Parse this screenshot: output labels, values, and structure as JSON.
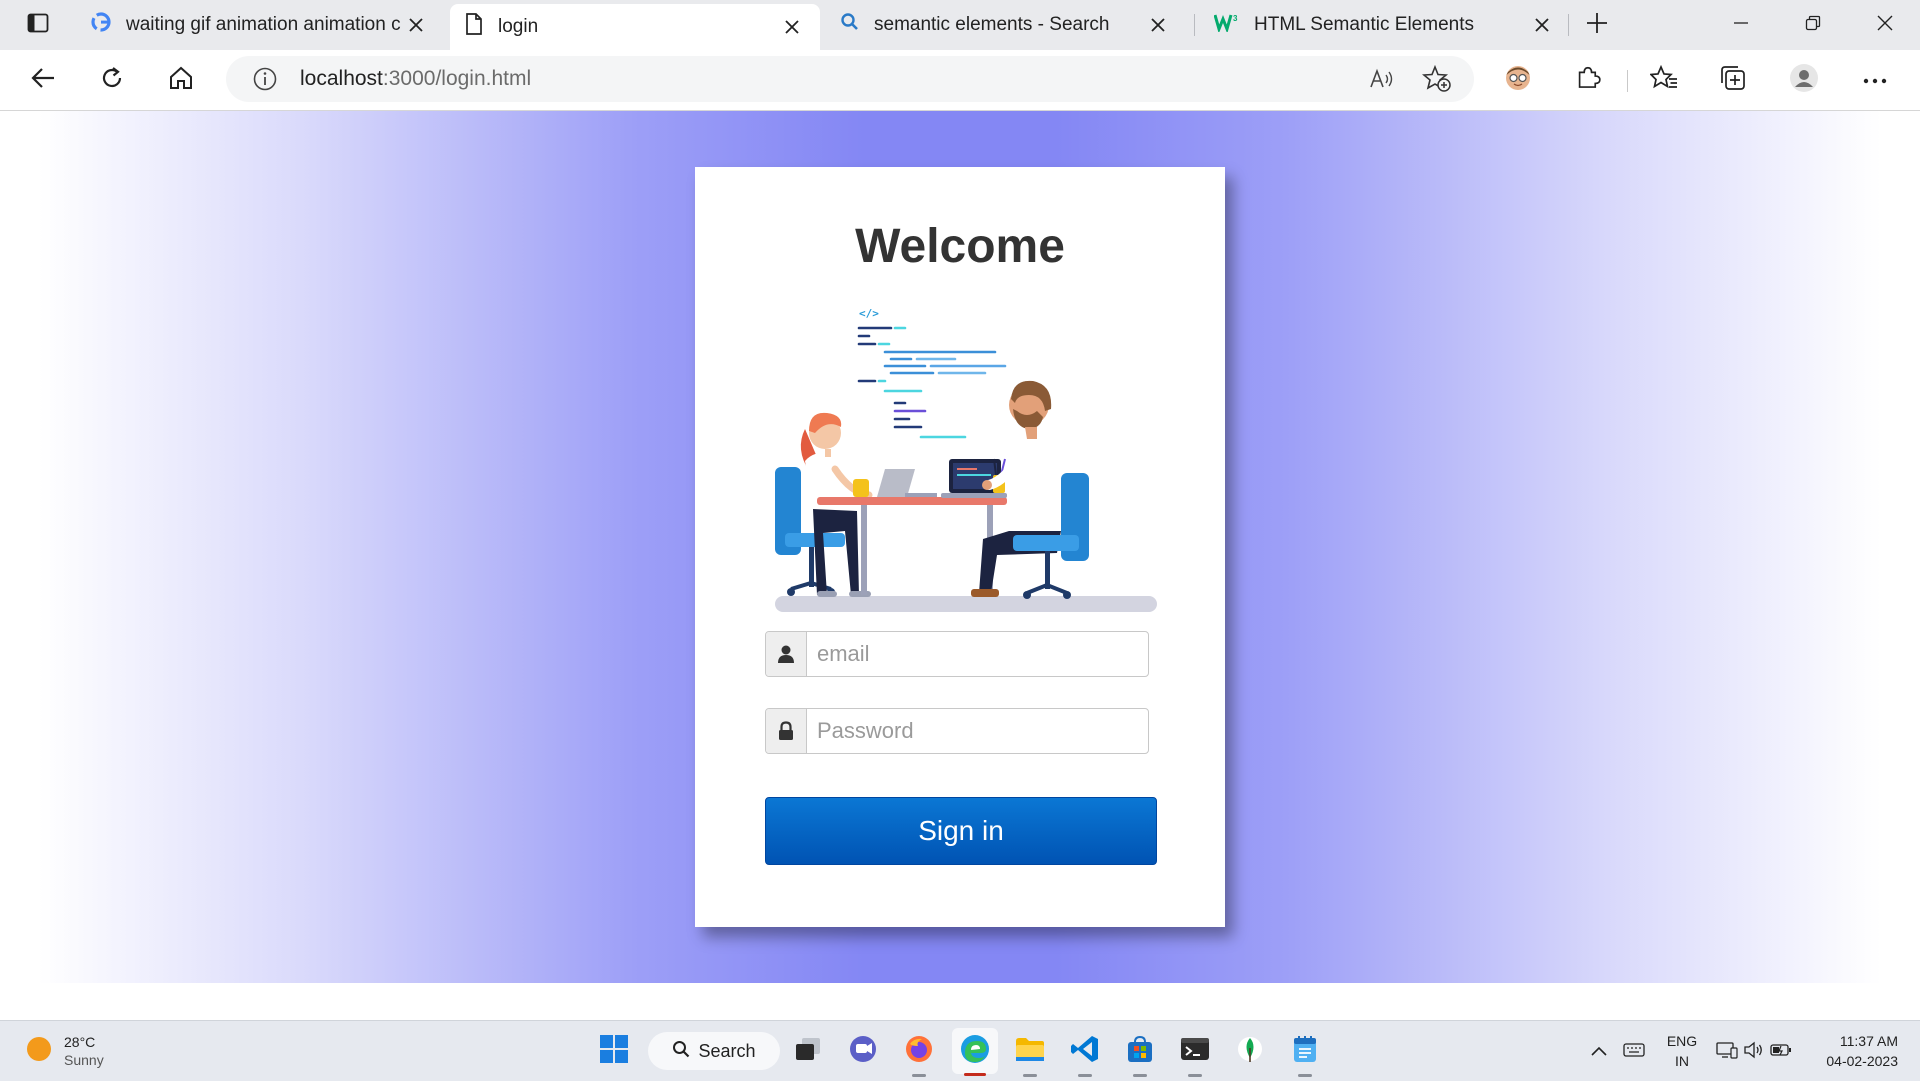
{
  "browser": {
    "tabs": [
      {
        "title": "waiting gif animation animation c",
        "icon": "google-icon",
        "active": false
      },
      {
        "title": "login",
        "icon": "page-icon",
        "active": true
      },
      {
        "title": "semantic elements - Search",
        "icon": "search-icon",
        "active": false
      },
      {
        "title": "HTML Semantic Elements",
        "icon": "w3schools-icon",
        "active": false
      }
    ],
    "address": {
      "host": "localhost",
      "rest": ":3000/login.html"
    }
  },
  "login": {
    "title": "Welcome",
    "email_placeholder": "email",
    "password_placeholder": "Password",
    "signin_label": "Sign in",
    "illustration_code_tag": "</>"
  },
  "taskbar": {
    "weather": {
      "temp": "28°C",
      "condition": "Sunny"
    },
    "search_label": "Search",
    "lang": {
      "line1": "ENG",
      "line2": "IN"
    },
    "clock": {
      "time": "11:37 AM",
      "date": "04-02-2023"
    }
  },
  "colors": {
    "page_gradient_center": "#8487f4",
    "signin_button": "#0064c8",
    "tabstrip": "#e9eaed"
  }
}
